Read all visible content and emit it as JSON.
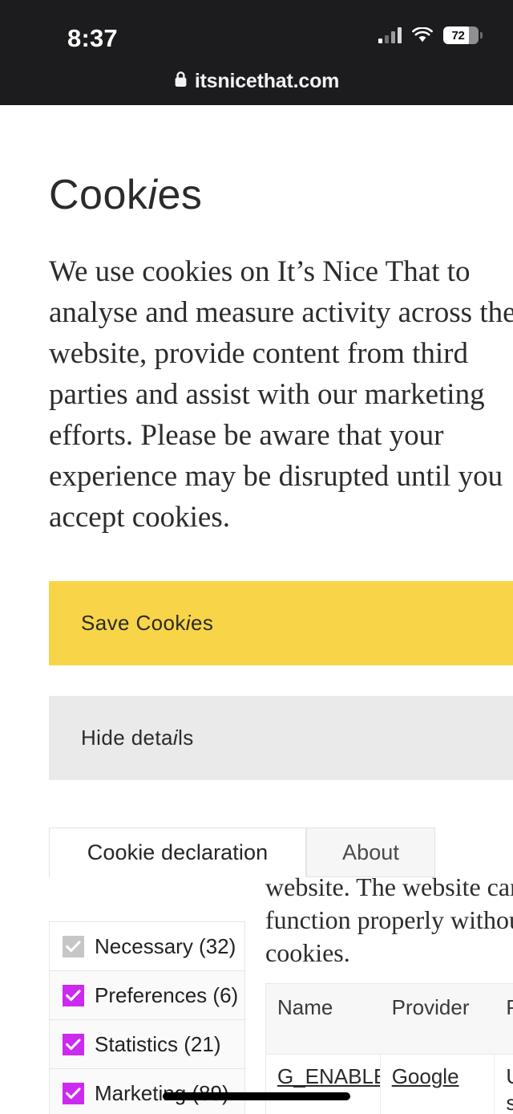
{
  "status_bar": {
    "time": "8:37",
    "battery_percent": "72",
    "signal_icon": "cellular-signal-icon",
    "wifi_icon": "wifi-icon",
    "battery_icon": "battery-icon"
  },
  "browser": {
    "lock_icon": "lock-icon",
    "host": "itsnicethat.com"
  },
  "dialog": {
    "heading_a": "Cook",
    "heading_i": "i",
    "heading_b": "es",
    "body": "We use cookies on It’s Nice That to analyse and measure activity across the website, provide content from third parties and assist with our marketing efforts. Please be aware that your experience may be disrupted until you accept cookies.",
    "save_label_a": "Save Cook",
    "save_label_i": "i",
    "save_label_b": "es",
    "hide_label_a": "Hide deta",
    "hide_label_i": "i",
    "hide_label_b": "ls"
  },
  "consent": {
    "tabs": [
      {
        "label": "Cookie declaration",
        "active": true
      },
      {
        "label": "About",
        "active": false
      }
    ],
    "overflow_text_lines": [
      "website. The website can",
      "function properly without",
      "cookies."
    ],
    "categories": [
      {
        "label": "Necessary (32)",
        "checked": true,
        "disabled": true
      },
      {
        "label": "Preferences (6)",
        "checked": true,
        "disabled": false
      },
      {
        "label": "Statistics (21)",
        "checked": true,
        "disabled": false
      },
      {
        "label": "Marketing (89)",
        "checked": true,
        "disabled": false
      }
    ],
    "table": {
      "columns": [
        "Name",
        "Provider",
        "P"
      ],
      "rows": [
        {
          "name": "G_ENABLED",
          "provider": "Google",
          "purpose": "U",
          "purpose_2": "s"
        }
      ]
    }
  },
  "colors": {
    "accent_yellow": "#F8D548",
    "checkbox_magenta": "#CC2AEE",
    "checkbox_disabled": "#C6C6C6",
    "chrome_background": "#1C1C1E",
    "secondary_button": "#EAEAEA"
  }
}
